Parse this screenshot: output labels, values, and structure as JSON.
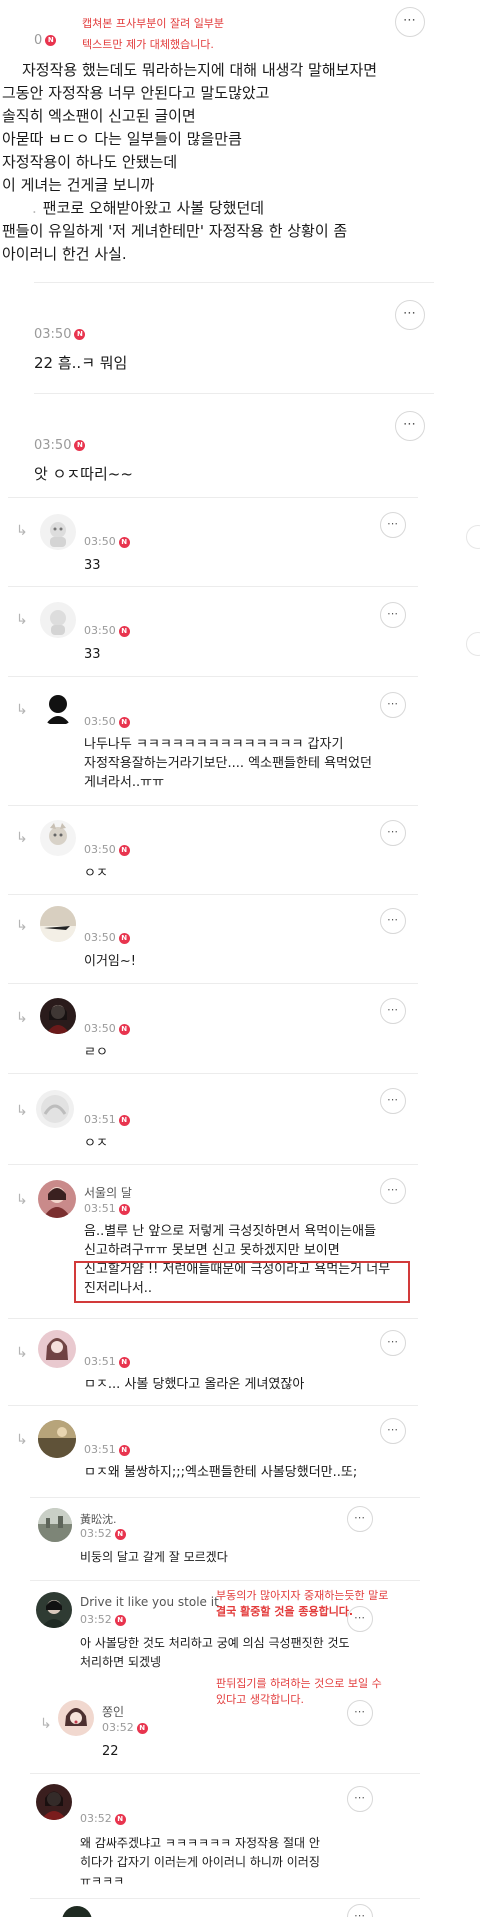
{
  "top": {
    "count": "0",
    "notice": [
      "캡쳐본 프사부분이 잘려 일부분",
      "텍스트만 제가 대체했습니다."
    ],
    "post_lines": [
      "자정작용 했는데도 뭐라하는지에 대해 내생각 말해보자면",
      "그동안 자정작용 너무 안된다고 말도많았고",
      "솔직히 엑소팬이 신고된 글이면",
      "아묻따 ㅂㄷㅇ 다는 일부들이 많을만큼",
      "자정작용이 하나도 안됐는데",
      "이 게녀는 건게글 보니까",
      "팬코로 오해받아왔고 사볼 당했던데",
      "팬들이 유일하게 '저 게녀한테만' 자정작용 한 상황이 좀",
      "아이러니 한건 사실."
    ],
    "dot": "."
  },
  "comments": [
    {
      "time": "03:50",
      "text": "22 흠..ㅋ 뭐임"
    },
    {
      "time": "03:50",
      "text": "앗 ㅇㅈ따리~~"
    }
  ],
  "replies": [
    {
      "time": "03:50",
      "text": "33"
    },
    {
      "time": "03:50",
      "text": "33"
    },
    {
      "time": "03:50",
      "lines": [
        "나두나두 ㅋㅋㅋㅋㅋㅋㅋㅋㅋㅋㅋㅋㅋㅋ 갑자기",
        "자정작용잘하는거라기보단.... 엑소팬들한테 욕먹었던",
        "게녀라서..ㅠㅠ"
      ]
    },
    {
      "time": "03:50",
      "text": "ㅇㅈ"
    },
    {
      "time": "03:50",
      "text": "이거임~!"
    },
    {
      "time": "03:50",
      "text": "ㄹㅇ"
    },
    {
      "time": "03:51",
      "text": "ㅇㅈ"
    },
    {
      "name": "서울의 달",
      "time": "03:51",
      "lines": [
        "음..별루 난 앞으로 저렇게 극성짓하면서 욕먹이는애들",
        "신고하려구ㅠㅠ 못보면 신고 못하겠지만 보이면",
        "신고할거얌 !! 저런애들때문에 극성이라고 욕먹는거 너무",
        "진저리나서.."
      ]
    },
    {
      "time": "03:51",
      "text": "ㅁㅈ... 사볼 당했다고 올라온 게녀였잖아"
    },
    {
      "time": "03:51",
      "text": "ㅁㅈ왜 불쌍하지;;;엑소팬들한테 사볼당했더만..또;"
    }
  ],
  "nested": [
    {
      "name": "黃昖沈.",
      "time": "03:52",
      "text": "비둥의 달고 갈게 잘 모르겠다"
    },
    {
      "name": "Drive it like you stole it",
      "time": "03:52",
      "lines": [
        "아 사볼당한 것도 처리하고 궁예 의심 극성팬짓한 것도",
        "처리하면 되겠넹"
      ]
    },
    {
      "name": "쫑인",
      "time": "03:52",
      "text": "22"
    },
    {
      "time": "03:52",
      "lines": [
        "왜 감싸주겠냐고 ㅋㅋㅋㅋㅋㅋ 자정작용 절대 안",
        "히다가 갑자기 이러는게 아이러니 하니까 이러징",
        "ㅠㅋㅋㅋ"
      ]
    }
  ],
  "annotations": {
    "note1": [
      "부동의가 많아지자 중재하는듯한 말로",
      "결국 활중할 것을 종용합니다."
    ],
    "note2": [
      "판뒤집기를 하려하는 것으로 보일 수",
      "있다고 생각합니다."
    ]
  },
  "icons": {
    "more": "⋯",
    "reply": "↳",
    "badge": "N"
  },
  "colors": {
    "badge": "#e8344e",
    "highlight_box": "#d23a3a",
    "annotation": "#e23b3b"
  }
}
